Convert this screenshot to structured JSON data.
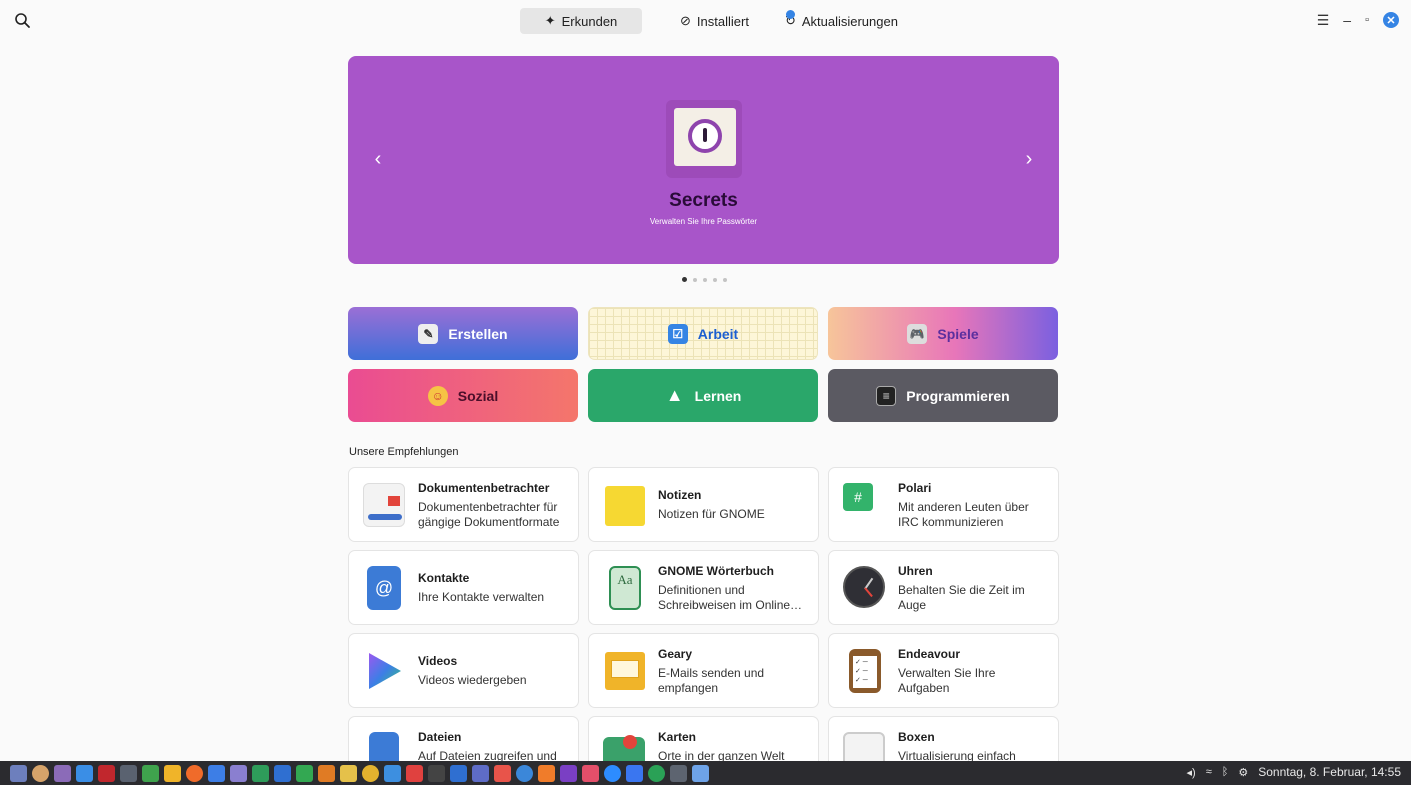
{
  "header": {
    "tabs": [
      {
        "label": "Erkunden",
        "icon": "compass-star-icon",
        "active": true
      },
      {
        "label": "Installiert",
        "icon": "check-circle-icon",
        "active": false
      },
      {
        "label": "Aktualisierungen",
        "icon": "refresh-icon",
        "active": false
      }
    ],
    "search_icon": "search-icon",
    "menu_icon": "hamburger-menu-icon",
    "window_controls": [
      "minimize-icon",
      "restore-icon",
      "close-icon"
    ]
  },
  "featured": {
    "title": "Secrets",
    "subtitle": "Verwalten Sie Ihre Passwörter",
    "background_color": "#a855c9",
    "page_count": 5,
    "current_page": 1
  },
  "categories": [
    {
      "label": "Erstellen"
    },
    {
      "label": "Arbeit"
    },
    {
      "label": "Spiele"
    },
    {
      "label": "Sozial"
    },
    {
      "label": "Lernen"
    },
    {
      "label": "Programmieren"
    }
  ],
  "recommendations": {
    "title": "Unsere Empfehlungen",
    "apps": [
      {
        "name": "Dokumentenbetrachter",
        "description": "Dokumentenbetrachter für gängige Dokumentformate"
      },
      {
        "name": "Notizen",
        "description": "Notizen für GNOME"
      },
      {
        "name": "Polari",
        "description": "Mit anderen Leuten über IRC kommunizieren"
      },
      {
        "name": "Kontakte",
        "description": "Ihre Kontakte verwalten"
      },
      {
        "name": "GNOME Wörterbuch",
        "description": "Definitionen und Schreibweisen im Online…"
      },
      {
        "name": "Uhren",
        "description": "Behalten Sie die Zeit im Auge"
      },
      {
        "name": "Videos",
        "description": "Videos wiedergeben"
      },
      {
        "name": "Geary",
        "description": "E-Mails senden und empfangen"
      },
      {
        "name": "Endeavour",
        "description": "Verwalten Sie Ihre Aufgaben"
      },
      {
        "name": "Dateien",
        "description": "Auf Dateien zugreifen und"
      },
      {
        "name": "Karten",
        "description": "Orte in der ganzen Welt"
      },
      {
        "name": "Boxen",
        "description": "Virtualisierung einfach"
      }
    ]
  },
  "taskbar": {
    "clock": "Sonntag, 8. Februar, 14:55",
    "tray_icons": [
      "volume-icon",
      "wifi-icon",
      "bluetooth-icon",
      "update-notifier-icon"
    ]
  },
  "colors": {
    "accent": "#3584e4",
    "carousel": "#a855c9",
    "learn": "#2aa76a",
    "dev": "#5b5a62"
  }
}
